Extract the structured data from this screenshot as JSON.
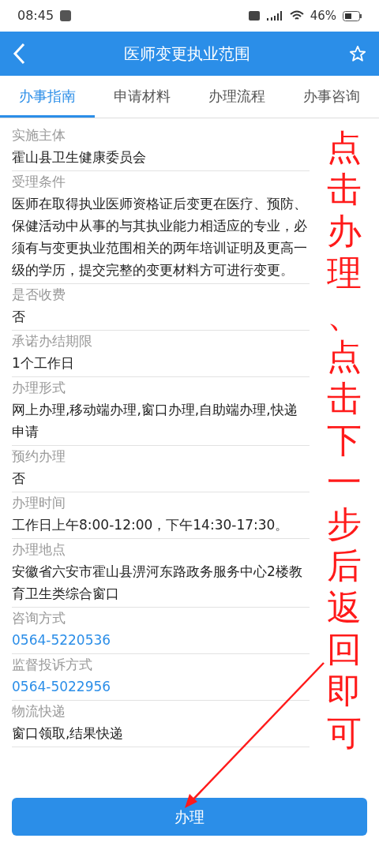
{
  "status_bar": {
    "time": "08:45",
    "battery": "46%"
  },
  "header": {
    "title": "医师变更执业范围"
  },
  "tabs": [
    {
      "label": "办事指南",
      "selected": true
    },
    {
      "label": "申请材料",
      "selected": false
    },
    {
      "label": "办理流程",
      "selected": false
    },
    {
      "label": "办事咨询",
      "selected": false
    }
  ],
  "fields": [
    {
      "label": "实施主体",
      "value": "霍山县卫生健康委员会",
      "kind": "text"
    },
    {
      "label": "受理条件",
      "value": "医师在取得执业医师资格证后变更在医疗、预防、保健活动中从事的与其执业能力相适应的专业，必须有与变更执业范围相关的两年培训证明及更高一级的学历，提交完整的变更材料方可进行变更。",
      "kind": "text"
    },
    {
      "label": "是否收费",
      "value": "否",
      "kind": "text"
    },
    {
      "label": "承诺办结期限",
      "value": "1个工作日",
      "kind": "text"
    },
    {
      "label": "办理形式",
      "value": "网上办理,移动端办理,窗口办理,自助端办理,快递申请",
      "kind": "text"
    },
    {
      "label": "预约办理",
      "value": "否",
      "kind": "text"
    },
    {
      "label": "办理时间",
      "value": "工作日上午8:00-12:00，下午14:30-17:30。",
      "kind": "text"
    },
    {
      "label": "办理地点",
      "value": "安徽省六安市霍山县淠河东路政务服务中心2楼教育卫生类综合窗口",
      "kind": "text"
    },
    {
      "label": "咨询方式",
      "value": "0564-5220536",
      "kind": "phone"
    },
    {
      "label": "监督投诉方式",
      "value": "0564-5022956",
      "kind": "phone"
    },
    {
      "label": "物流快递",
      "value": "窗口领取,结果快递",
      "kind": "text"
    }
  ],
  "action_button": "办理",
  "annotation": "点击办理、点击下一步后返回即可"
}
